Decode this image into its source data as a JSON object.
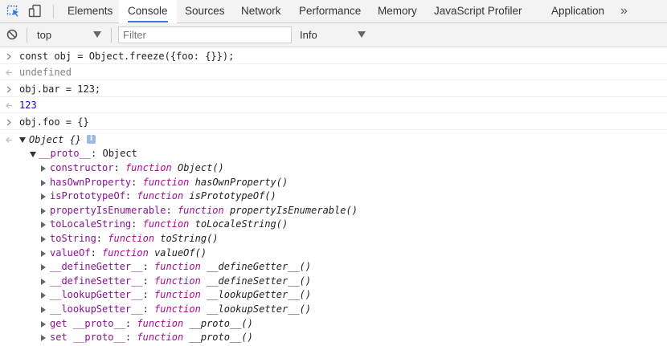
{
  "tabs": [
    {
      "label": "Elements",
      "active": false
    },
    {
      "label": "Console",
      "active": true
    },
    {
      "label": "Sources",
      "active": false
    },
    {
      "label": "Network",
      "active": false
    },
    {
      "label": "Performance",
      "active": false
    },
    {
      "label": "Memory",
      "active": false
    },
    {
      "label": "JavaScript Profiler",
      "active": false
    },
    {
      "label": "Application",
      "active": false
    }
  ],
  "more_tabs_label": "»",
  "toolbar": {
    "context": "top",
    "filter_placeholder": "Filter",
    "log_level": "Info"
  },
  "console": {
    "lines": [
      {
        "type": "input",
        "text": "const obj = Object.freeze({foo: {}});"
      },
      {
        "type": "result",
        "text": "undefined"
      },
      {
        "type": "input",
        "text": "obj.bar = 123;"
      },
      {
        "type": "result",
        "text": "123"
      },
      {
        "type": "input",
        "text": "obj.foo = {}"
      }
    ],
    "object_summary": "Object {}",
    "info_badge": "i",
    "proto_label": "__proto__",
    "proto_value": "Object",
    "proto_members": [
      {
        "name": "constructor",
        "kw": "function",
        "sig": "Object()"
      },
      {
        "name": "hasOwnProperty",
        "kw": "function",
        "sig": "hasOwnProperty()"
      },
      {
        "name": "isPrototypeOf",
        "kw": "function",
        "sig": "isPrototypeOf()"
      },
      {
        "name": "propertyIsEnumerable",
        "kw": "function",
        "sig": "propertyIsEnumerable()"
      },
      {
        "name": "toLocaleString",
        "kw": "function",
        "sig": "toLocaleString()"
      },
      {
        "name": "toString",
        "kw": "function",
        "sig": "toString()"
      },
      {
        "name": "valueOf",
        "kw": "function",
        "sig": "valueOf()"
      },
      {
        "name": "__defineGetter__",
        "kw": "function",
        "sig": "__defineGetter__()"
      },
      {
        "name": "__defineSetter__",
        "kw": "function",
        "sig": "__defineSetter__()"
      },
      {
        "name": "__lookupGetter__",
        "kw": "function",
        "sig": "__lookupGetter__()"
      },
      {
        "name": "__lookupSetter__",
        "kw": "function",
        "sig": "__lookupSetter__()"
      },
      {
        "name": "get __proto__",
        "kw": "function",
        "sig": "__proto__()"
      },
      {
        "name": "set __proto__",
        "kw": "function",
        "sig": "__proto__()"
      }
    ]
  },
  "colors": {
    "accent": "#3879d9",
    "property_name": "#881391",
    "function_keyword": "#aa0d91",
    "number": "#1c00cf",
    "undefined": "#808080"
  }
}
